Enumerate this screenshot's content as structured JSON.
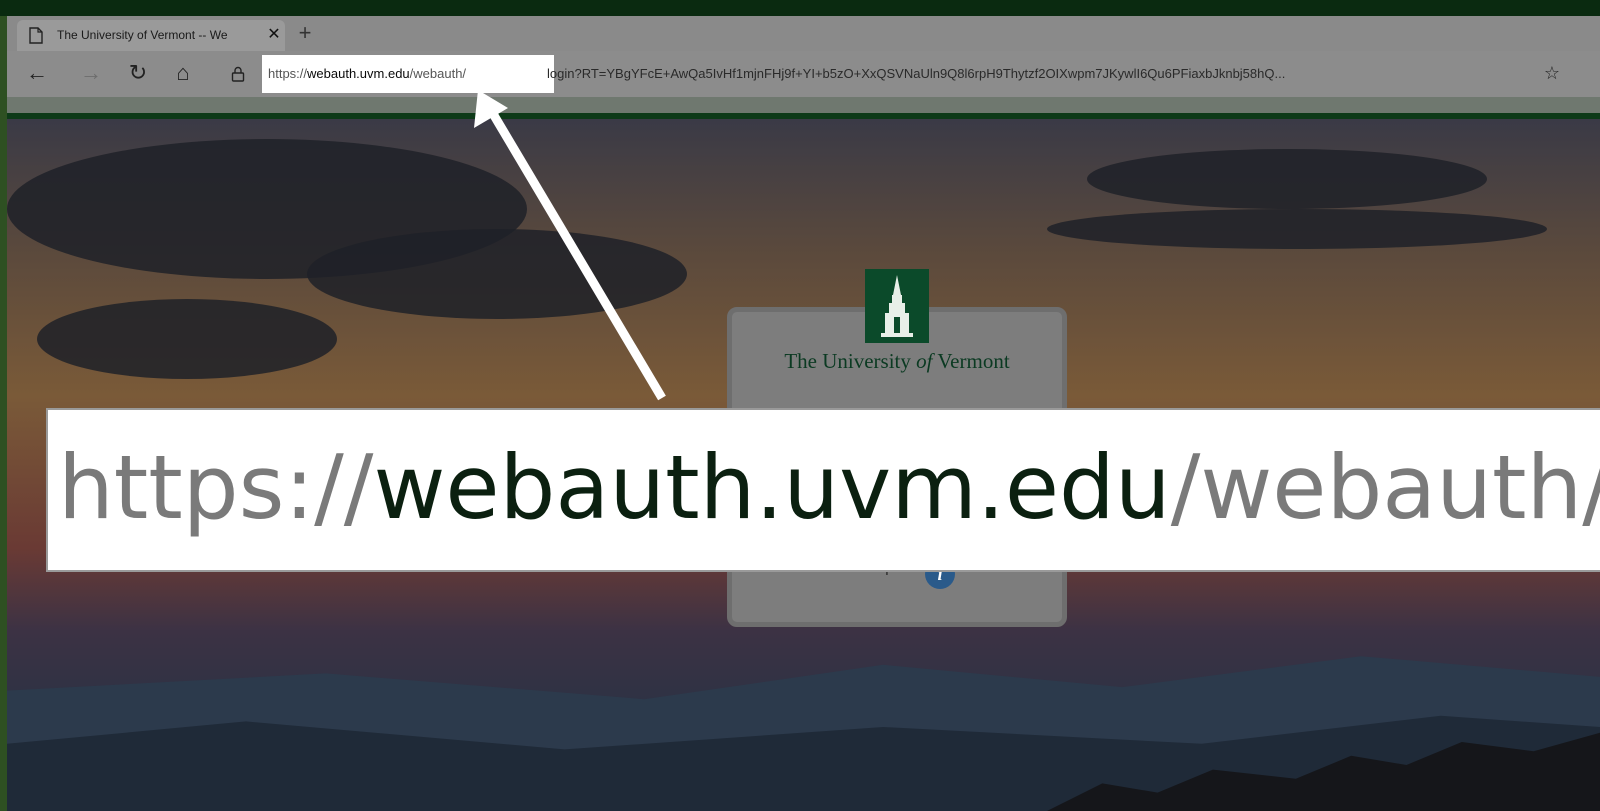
{
  "browser": {
    "tab_title": "The University of Vermont -- We",
    "close_glyph": "✕",
    "new_tab_glyph": "+",
    "back_glyph": "←",
    "forward_glyph": "→",
    "reload_glyph": "↻",
    "home_glyph": "⌂",
    "favorites_glyph": "☆",
    "url": {
      "scheme": "https://",
      "host": "webauth.uvm.edu",
      "path": "/webauth/",
      "query": "login?RT=YBgYFcE+AwQa5IvHf1mjnFHj9f+YI+b5zO+XxQSVNaUln9Q8l6rpH9Thytzf2OIXwpm7JKywlI6Qu6PFiaxbJknbj58hQ..."
    }
  },
  "page": {
    "institution_name_pre": "The University ",
    "institution_name_of": "of",
    "institution_name_post": " Vermont",
    "help_text": "Need Help?",
    "help_icon_glyph": "i"
  },
  "callout": {
    "scheme": "https://",
    "host": "webauth.uvm.edu",
    "path": "/webauth/l"
  },
  "colors": {
    "uvm_green": "#0b4a2a",
    "callout_host": "#0b2010",
    "callout_dim": "#7a7a7a"
  }
}
